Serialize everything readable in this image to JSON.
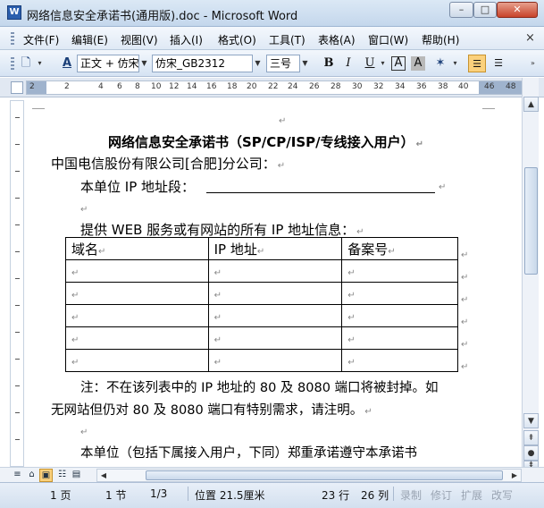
{
  "window": {
    "title": "网络信息安全承诺书(通用版).doc - Microsoft Word",
    "minimize": "–",
    "maximize": "□",
    "close": "✕"
  },
  "menu": {
    "items": [
      "文件(F)",
      "编辑(E)",
      "视图(V)",
      "插入(I)",
      "格式(O)",
      "工具(T)",
      "表格(A)",
      "窗口(W)",
      "帮助(H)"
    ],
    "close_doc": "×"
  },
  "toolbar": {
    "style_value": "正文 + 仿宋",
    "font_value": "仿宋_GB2312",
    "size_value": "三号",
    "bold": "B",
    "italic": "I",
    "underline": "U",
    "char_border": "A",
    "char_shading": "A"
  },
  "ruler": {
    "numbers": [
      "2",
      "2",
      "4",
      "6",
      "8",
      "10",
      "12",
      "14",
      "16",
      "18",
      "20",
      "22",
      "24",
      "26",
      "28",
      "30",
      "32",
      "34",
      "36",
      "38",
      "40",
      "42",
      "46",
      "48"
    ]
  },
  "document": {
    "title": "网络信息安全承诺书（SP/CP/ISP/专线接入用户）",
    "recipient": "中国电信股份有限公司[合肥]分公司：",
    "ip_segment_label": "本单位 IP 地址段：",
    "web_info_label": "提供 WEB 服务或有网站的所有 IP 地址信息：",
    "table_headers": [
      "域名",
      "IP 地址",
      "备案号"
    ],
    "table_rows": 5,
    "note_line1": "注：不在该列表中的 IP 地址的 80 及 8080 端口将被封掉。如",
    "note_line2": "无网站但仍对 80 及 8080 端口有特别需求，请注明。",
    "commitment": "本单位（包括下属接入用户，下同）郑重承诺遵守本承诺书",
    "para_mark": "↵"
  },
  "statusbar": {
    "page": "1 页",
    "section": "1 节",
    "page_of": "1/3",
    "position": "位置 21.5厘米",
    "line": "23 行",
    "column": "26 列",
    "rec": "录制",
    "trk": "修订",
    "ext": "扩展",
    "ovr": "改写"
  }
}
